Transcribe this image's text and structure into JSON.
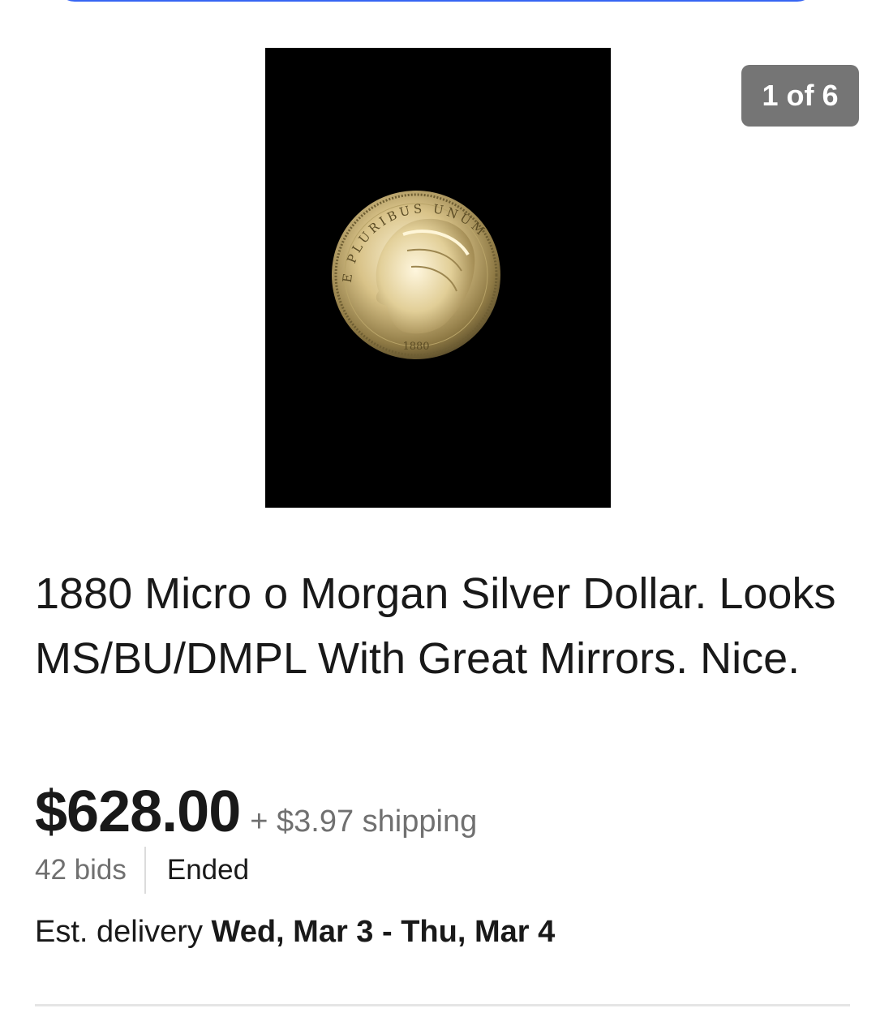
{
  "gallery": {
    "counter": "1 of 6",
    "coin_legend": "E PLURIBUS UNUM",
    "coin_date": "1880"
  },
  "listing": {
    "title": "1880 Micro o Morgan Silver Dollar. Looks MS/BU/DMPL With Great Mirrors. Nice.",
    "price": "$628.00",
    "shipping": "+ $3.97 shipping",
    "bids": "42 bids",
    "status": "Ended",
    "delivery_label": "Est. delivery",
    "delivery_range": "Wed, Mar 3 - Thu, Mar 4"
  },
  "colors": {
    "accent": "#3665f3",
    "counter_bg": "#757575",
    "secondary_text": "#707070"
  }
}
